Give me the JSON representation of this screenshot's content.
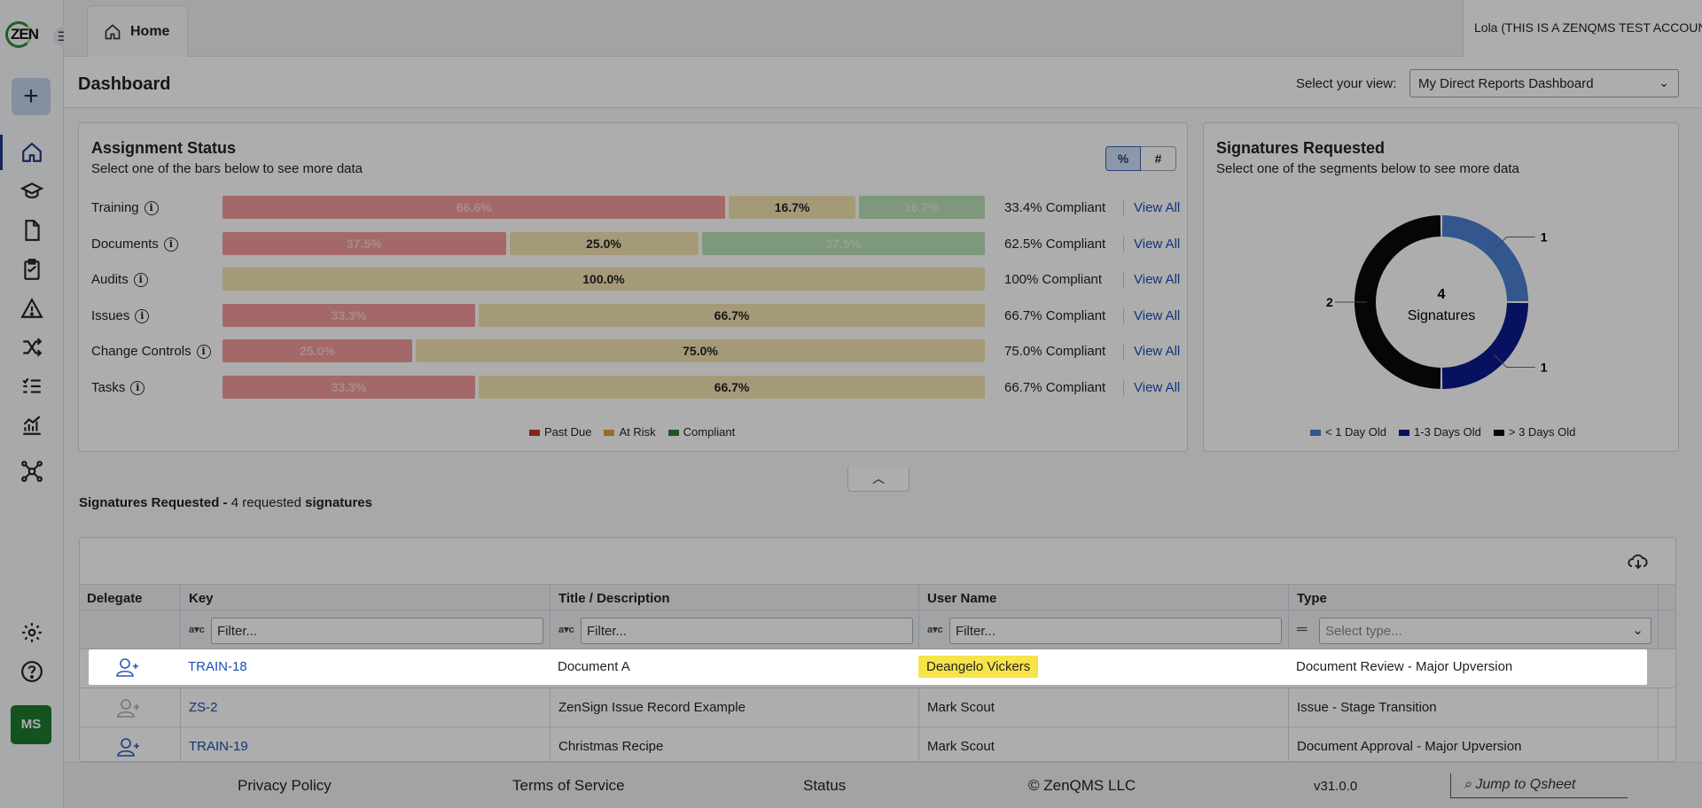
{
  "app": {
    "logo_text": "ZEN",
    "home_tab": "Home",
    "account": "Lola (THIS IS A ZENQMS TEST ACCOUNT)",
    "avatar_initials": "MS"
  },
  "dashboard": {
    "title": "Dashboard",
    "view_label": "Select your view:",
    "view_value": "My Direct Reports Dashboard"
  },
  "assignment": {
    "title": "Assignment Status",
    "subtitle": "Select one of the bars below to see more data",
    "toggle_pct": "%",
    "toggle_num": "#",
    "rows": [
      {
        "label": "Training",
        "past_due": "66.6%",
        "at_risk": "16.7%",
        "compliant": "16.7%",
        "summary": "33.4% Compliant",
        "link": "View All"
      },
      {
        "label": "Documents",
        "past_due": "37.5%",
        "at_risk": "25.0%",
        "compliant": "37.5%",
        "summary": "62.5% Compliant",
        "link": "View All"
      },
      {
        "label": "Audits",
        "past_due": "",
        "at_risk": "100.0%",
        "compliant": "",
        "summary": "100% Compliant",
        "link": "View All"
      },
      {
        "label": "Issues",
        "past_due": "33.3%",
        "at_risk": "66.7%",
        "compliant": "",
        "summary": "66.7% Compliant",
        "link": "View All"
      },
      {
        "label": "Change Controls",
        "past_due": "25.0%",
        "at_risk": "75.0%",
        "compliant": "",
        "summary": "75.0% Compliant",
        "link": "View All"
      },
      {
        "label": "Tasks",
        "past_due": "33.3%",
        "at_risk": "66.7%",
        "compliant": "",
        "summary": "66.7% Compliant",
        "link": "View All"
      }
    ],
    "legend": [
      "Past Due",
      "At Risk",
      "Compliant"
    ],
    "colors": {
      "past_due": "#c0392b",
      "at_risk": "#e0a030",
      "compliant": "#2e7d32"
    }
  },
  "signatures": {
    "title": "Signatures Requested",
    "subtitle": "Select one of the segments below to see more data",
    "center_count": "4",
    "center_label": "Signatures",
    "segments": [
      {
        "label": "< 1 Day Old",
        "value": 1,
        "color": "#4a7fd0"
      },
      {
        "label": "1-3 Days Old",
        "value": 1,
        "color": "#0b1a8c"
      },
      {
        "label": "> 3 Days Old",
        "value": 2,
        "color": "#0a0a0a"
      }
    ],
    "value_labels": [
      "1",
      "1",
      "2"
    ]
  },
  "sig_section": {
    "prefix": "Signatures Requested -",
    "count_text": "4 requested",
    "suffix": "signatures"
  },
  "table": {
    "headers": [
      "Delegate",
      "Key",
      "Title / Description",
      "User Name",
      "Type"
    ],
    "filter_placeholder": "Filter...",
    "type_placeholder": "Select type...",
    "rows": [
      {
        "key": "TRAIN-18",
        "title": "Document A",
        "user": "Deangelo Vickers",
        "type": "Document Review - Major Upversion"
      },
      {
        "key": "ZS-2",
        "title": "ZenSign Issue Record Example",
        "user": "Mark Scout",
        "type": "Issue - Stage Transition"
      },
      {
        "key": "TRAIN-19",
        "title": "Christmas Recipe",
        "user": "Mark Scout",
        "type": "Document Approval - Major Upversion"
      }
    ]
  },
  "footer": {
    "privacy": "Privacy Policy",
    "terms": "Terms of Service",
    "status": "Status",
    "copyright": "© ZenQMS LLC",
    "version": "v31.0.0",
    "jump": "Jump to Qsheet"
  }
}
